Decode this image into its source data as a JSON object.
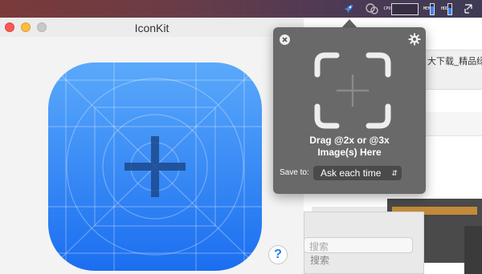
{
  "window": {
    "title": "IconKit",
    "help_label": "?"
  },
  "menubar": {
    "cpu_label": "CPU",
    "mem_label": "MEM",
    "hdd_label": "HDD",
    "mem_fill": 0.75,
    "hdd_fill": 0.55,
    "icons": [
      "rocket-icon",
      "chat-bubble-icon",
      "network-arrows-icon"
    ]
  },
  "popover": {
    "drop_text_line1": "Drag @2x or @3x",
    "drop_text_line2": "Image(s) Here",
    "save_to_label": "Save to:",
    "save_to_value": "Ask each time",
    "icons": [
      "close-icon",
      "gear-icon",
      "drop-frame-icon",
      "plus-icon"
    ]
  },
  "background_window": {
    "text_snippet": "大下载_精品绿色",
    "search_placeholder": "搜索",
    "search_label": "搜索"
  },
  "colors": {
    "icon_blue_top": "#5aa9fb",
    "icon_blue_bottom": "#1b6ef0",
    "popover_bg": "#646464",
    "help_blue": "#1f7bf6"
  }
}
